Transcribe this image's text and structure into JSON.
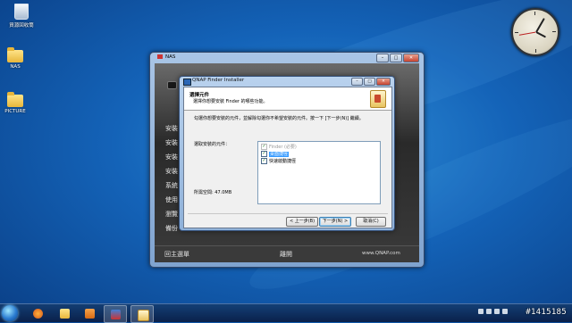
{
  "desktop": {
    "icons": [
      {
        "label": "資源回收筒"
      },
      {
        "label": "NAS"
      },
      {
        "label": "PICTURE"
      }
    ]
  },
  "nas_window": {
    "title": "NAS",
    "min": "–",
    "max": "□",
    "close": "✕",
    "menu_items": [
      "安裝",
      "安裝",
      "安裝",
      "安裝",
      "系統",
      "使用",
      "瀏覽",
      "備份"
    ],
    "footer_main": "回主選單",
    "footer_exit": "離開",
    "footer_url": "www.QNAP.com"
  },
  "installer": {
    "title": "QNAP Finder Installer",
    "min": "–",
    "max": "□",
    "close": "✕",
    "header_title": "選擇元件",
    "header_subtitle": "選擇你想要安裝 Finder 的哪些功能。",
    "description": "勾選你想要安裝的元件，並解除勾選你不希望安裝的元件。按一下 [下一步(N)] 繼續。",
    "choose_label": "選取安裝的元件：",
    "space_label": "所需空間: 47.0MB",
    "components": [
      {
        "label": "Finder (必要)",
        "checked": true,
        "disabled": true,
        "selected": false
      },
      {
        "label": "桌面捷徑",
        "checked": true,
        "disabled": false,
        "selected": true
      },
      {
        "label": "快速啟動捷徑",
        "checked": true,
        "disabled": false,
        "selected": false
      }
    ],
    "back_label": "< 上一步(B)",
    "next_label": "下一步(N) >",
    "cancel_label": "取消(C)"
  },
  "taskbar": {
    "tray_time": "",
    "watermark": "#1415185"
  },
  "colors": {
    "accent": "#3399ff",
    "desktop": "#1463b8"
  }
}
